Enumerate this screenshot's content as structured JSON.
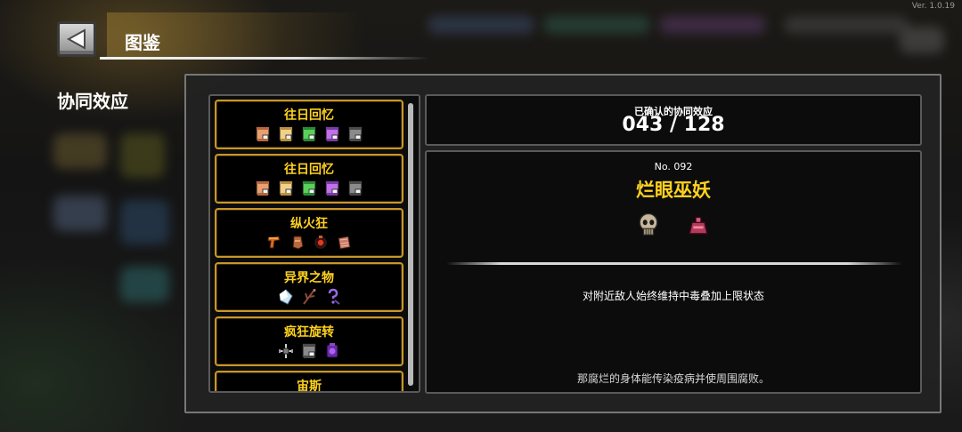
{
  "app": {
    "version": "Ver. 1.0.19"
  },
  "header": {
    "title": "图鉴",
    "back_icon": "back-arrow-icon"
  },
  "sidebar": {
    "label": "协同效应"
  },
  "synergy_list": [
    {
      "name": "往日回忆",
      "items": [
        "tan-scroll-icon",
        "yellow-scroll-icon",
        "green-scroll-icon",
        "purple-scroll-icon",
        "grey-scroll-icon"
      ]
    },
    {
      "name": "往日回忆",
      "items": [
        "tan-scroll-icon",
        "yellow-scroll-icon",
        "green-scroll-icon",
        "purple-scroll-icon",
        "grey-scroll-icon"
      ]
    },
    {
      "name": "纵火狂",
      "items": [
        "flame-gun-icon",
        "leather-glove-icon",
        "fire-orb-icon",
        "meat-chunk-icon"
      ]
    },
    {
      "name": "异界之物",
      "items": [
        "crystal-shard-icon",
        "branch-staff-icon",
        "question-key-icon"
      ]
    },
    {
      "name": "疯狂旋转",
      "items": [
        "spinning-cross-icon",
        "grey-scroll-icon",
        "purple-gem-icon"
      ]
    },
    {
      "name": "宙斯",
      "items": []
    }
  ],
  "confirmed": {
    "label": "已确认的协同效应",
    "value": "043 / 128"
  },
  "detail": {
    "number": "No. 092",
    "name": "烂眼巫妖",
    "items": [
      "skull-mask-icon",
      "pink-bag-icon"
    ],
    "effect": "对附近敌人始终维持中毒叠加上限状态",
    "flavor": "那腐烂的身体能传染疫病并使周围腐败。"
  },
  "colors": {
    "accent": "#ffd21e",
    "card_border": "#c8962a",
    "panel": "#222222"
  }
}
